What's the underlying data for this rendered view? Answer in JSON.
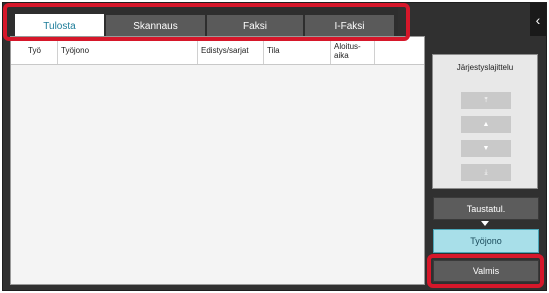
{
  "tabs": [
    {
      "label": "Tulosta",
      "active": true
    },
    {
      "label": "Skannaus",
      "active": false
    },
    {
      "label": "Faksi",
      "active": false
    },
    {
      "label": "I-Faksi",
      "active": false
    }
  ],
  "table": {
    "columns": [
      "Työ",
      "Työjono",
      "Edistys/sarjat",
      "Tila",
      "Aloitus-aika"
    ]
  },
  "sort": {
    "label": "Järjestyslajittelu",
    "buttons": [
      "⤒",
      "▲",
      "▼",
      "⤓"
    ]
  },
  "buttons": {
    "background": "Taustatul.",
    "queue": "Työjono",
    "done": "Valmis"
  },
  "icons": {
    "back": "‹"
  },
  "colors": {
    "highlight": "#d6172a",
    "active_tab_text": "#1c7c99",
    "queue_button": "#a8dfe9"
  }
}
